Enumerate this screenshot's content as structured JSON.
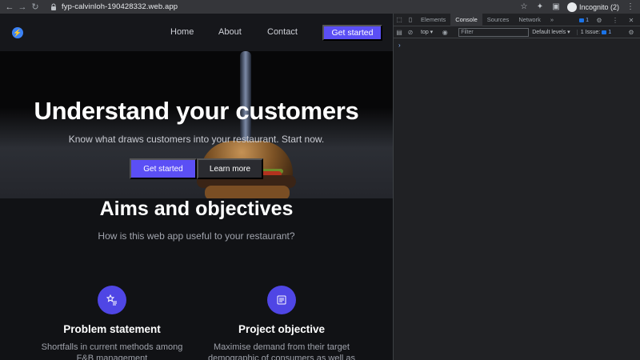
{
  "browser": {
    "url": "fyp-calvinloh-190428332.web.app",
    "incognito_label": "Incognito (2)"
  },
  "site": {
    "nav": {
      "links": [
        "Home",
        "About",
        "Contact"
      ],
      "cta_label": "Get started"
    },
    "hero": {
      "title": "Understand your customers",
      "subtitle": "Know what draws customers into your restaurant. Start now.",
      "primary_button": "Get started",
      "secondary_button": "Learn more"
    },
    "aims": {
      "title": "Aims and objectives",
      "subtitle": "How is this web app useful to your restaurant?"
    },
    "features": [
      {
        "icon": "star-list-icon",
        "title": "Problem statement",
        "description": "Shortfalls in current methods among F&B management"
      },
      {
        "icon": "document-icon",
        "title": "Project objective",
        "description": "Maximise demand from their target demographic of consumers as well as"
      }
    ],
    "colors": {
      "accent": "#5b4ff5",
      "feature_icon_bg": "#4f46e5",
      "logo": "#3b82f6"
    }
  },
  "devtools": {
    "tabs": [
      "Elements",
      "Console",
      "Sources",
      "Network"
    ],
    "active_tab": "Console",
    "more_tabs": "»",
    "message_count": "1",
    "context": "top",
    "filter_placeholder": "Filter",
    "levels_label": "Default levels",
    "issues_label": "1 Issue:",
    "issues_count": "1",
    "prompt": "›"
  }
}
